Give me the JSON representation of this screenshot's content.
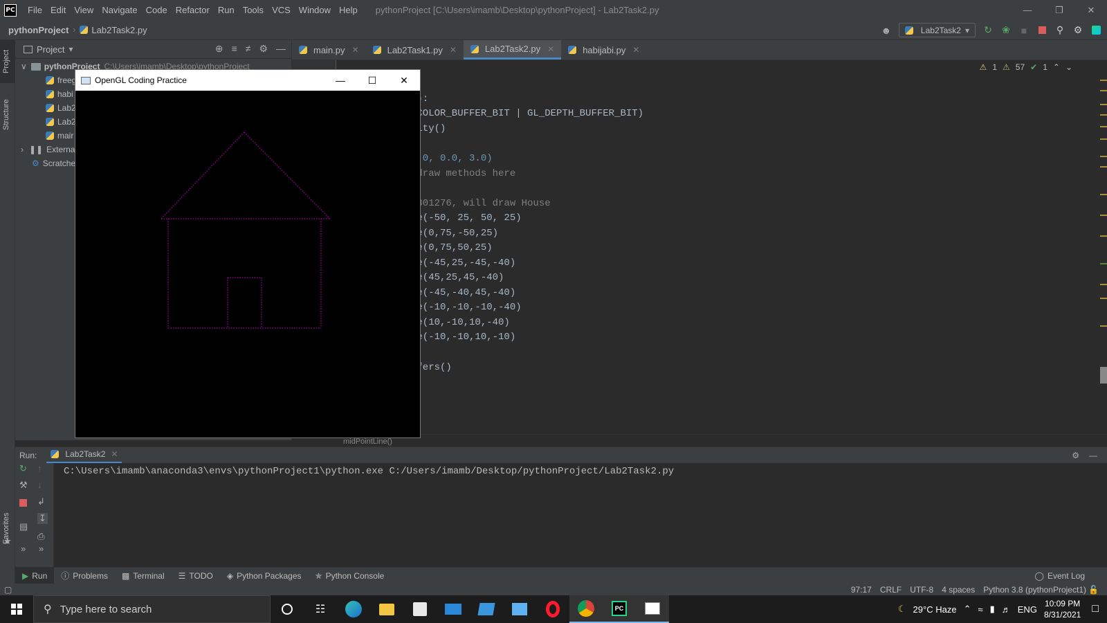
{
  "titlebar": {
    "logo": "PC",
    "menu": [
      "File",
      "Edit",
      "View",
      "Navigate",
      "Code",
      "Refactor",
      "Run",
      "Tools",
      "VCS",
      "Window",
      "Help"
    ],
    "window_title": "pythonProject [C:\\Users\\imamb\\Desktop\\pythonProject] - Lab2Task2.py"
  },
  "navbar": {
    "project": "pythonProject",
    "file": "Lab2Task2.py",
    "run_config": "Lab2Task2"
  },
  "left_strip": {
    "project_label": "Project",
    "structure_label": "Structure",
    "favorites_label": "Favorites"
  },
  "project_panel": {
    "title": "Project",
    "root": "pythonProject",
    "root_path": "C:\\Users\\imamb\\Desktop\\pythonProject",
    "files": [
      "freeg",
      "habi",
      "Lab2",
      "Lab2",
      "mair"
    ],
    "external": "External",
    "scratches": "Scratche"
  },
  "tabs": [
    {
      "label": "main.py"
    },
    {
      "label": "Lab2Task1.py"
    },
    {
      "label": "Lab2Task2.py"
    },
    {
      "label": "habijabi.py"
    }
  ],
  "editor": {
    "inspections": {
      "warn1": "1",
      "warn2": "57",
      "ok": "1"
    },
    "lines": [
      {
        "t": "():"
      },
      {
        "t": "_COLOR_BUFFER_BIT | GL_DEPTH_BUFFER_BIT)"
      },
      {
        "t": "tity()"
      },
      {
        "t": ""
      },
      {
        "t": "1.0, 0.0, 3.0)"
      },
      {
        "t": " draw methods here"
      },
      {
        "t": ""
      },
      {
        "t": "3301276, will draw House"
      },
      {
        "t": "ne(-50, 25, 50, 25)"
      },
      {
        "t": "ne(0,75,-50,25)"
      },
      {
        "t": "ne(0,75,50,25)"
      },
      {
        "t": "ne(-45,25,-45,-40)"
      },
      {
        "t": "ne(45,25,45,-40)"
      },
      {
        "t": "ne(-45,-40,45,-40)"
      },
      {
        "t": "ne(-10,-10,-10,-40)"
      },
      {
        "t": "ne(10,-10,10,-40)"
      },
      {
        "t": "ne(-10,-10,10,-10)"
      },
      {
        "t": ""
      },
      {
        "t": "ffers()"
      }
    ],
    "breadcrumb": "midPointLine()"
  },
  "gl_window": {
    "title": "OpenGL Coding Practice",
    "line_color": "#b000b0"
  },
  "run_panel": {
    "label": "Run:",
    "tab": "Lab2Task2",
    "console": "C:\\Users\\imamb\\anaconda3\\envs\\pythonProject1\\python.exe C:/Users/imamb/Desktop/pythonProject/Lab2Task2.py"
  },
  "bottom_tools": {
    "run": "Run",
    "problems": "Problems",
    "terminal": "Terminal",
    "todo": "TODO",
    "packages": "Python Packages",
    "console": "Python Console",
    "event_log": "Event Log"
  },
  "statusbar": {
    "position": "97:17",
    "line_sep": "CRLF",
    "encoding": "UTF-8",
    "indent": "4 spaces",
    "interpreter": "Python 3.8 (pythonProject1)"
  },
  "taskbar": {
    "search_placeholder": "Type here to search",
    "weather": "29°C  Haze",
    "lang": "ENG",
    "time": "10:09 PM",
    "date": "8/31/2021"
  },
  "colors": {
    "ide_bg": "#2b2b2b",
    "panel_bg": "#3c3f41",
    "accent": "#4a88c7",
    "house": "#b000b0"
  }
}
